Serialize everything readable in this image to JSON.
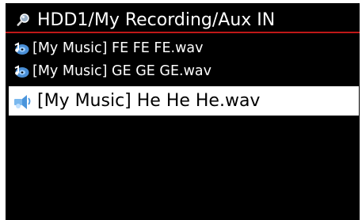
{
  "header": {
    "path": "HDD1/My Recording/Aux IN",
    "icon": "search-icon",
    "underline_color": "#c01818"
  },
  "files": [
    {
      "label": "[My Music] FE FE FE.wav",
      "icon": "music-cd-icon",
      "selected": false
    },
    {
      "label": "[My Music] GE GE GE.wav",
      "icon": "music-cd-icon",
      "selected": false
    },
    {
      "label": "[My Music] He He He.wav",
      "icon": "music-note-icon",
      "selected": true
    }
  ],
  "colors": {
    "background": "#000000",
    "text": "#ffffff",
    "selected_background": "#ffffff",
    "selected_text": "#000000"
  }
}
